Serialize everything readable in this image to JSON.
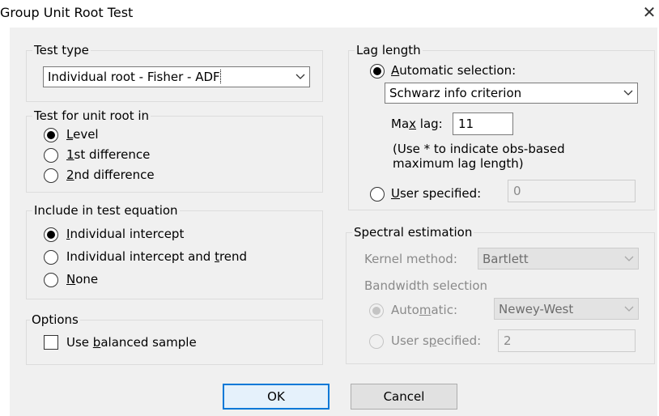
{
  "window": {
    "title": "Group Unit Root Test",
    "close_glyph": "✕"
  },
  "test_type": {
    "legend": "Test type",
    "selected": "Individual root - Fisher - ADF"
  },
  "unit_root": {
    "legend": "Test for unit root in",
    "options": [
      {
        "label": "Level",
        "checked": true
      },
      {
        "label": "1st difference",
        "checked": false
      },
      {
        "label": "2nd difference",
        "checked": false
      }
    ]
  },
  "equation": {
    "legend": "Include in test equation",
    "options": [
      {
        "label": "Individual intercept",
        "checked": true
      },
      {
        "label": "Individual intercept and trend",
        "checked": false
      },
      {
        "label": "None",
        "checked": false
      }
    ]
  },
  "options": {
    "legend": "Options",
    "balanced_label": "Use balanced sample",
    "balanced_checked": false
  },
  "lag": {
    "legend": "Lag length",
    "automatic_label": "Automatic selection:",
    "criterion": "Schwarz info criterion",
    "max_lag_label": "Max lag:",
    "max_lag_value": "11",
    "note_line1": "(Use * to indicate obs-based",
    "note_line2": "maximum lag length)",
    "user_label": "User specified:",
    "user_value": "0"
  },
  "spectral": {
    "legend": "Spectral estimation",
    "kernel_label": "Kernel method:",
    "kernel_value": "Bartlett",
    "bandwidth_label": "Bandwidth selection",
    "auto_label": "Automatic:",
    "auto_value": "Newey-West",
    "user_label": "User specified:",
    "user_value": "2"
  },
  "buttons": {
    "ok": "OK",
    "cancel": "Cancel"
  },
  "colors": {
    "accent": "#0078d7",
    "panel": "#f0f0f0"
  }
}
